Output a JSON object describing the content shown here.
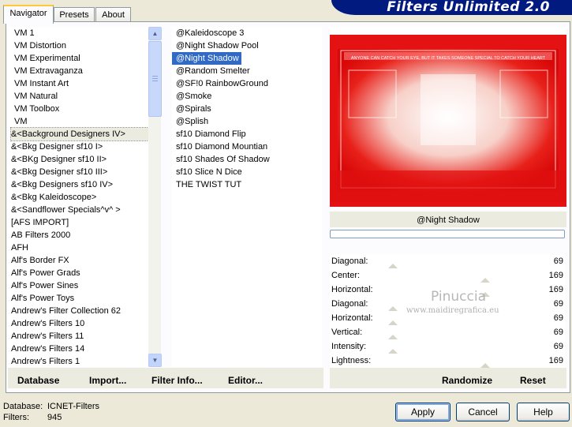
{
  "header": {
    "title": "Filters Unlimited 2.0"
  },
  "tabs": [
    {
      "label": "Navigator"
    },
    {
      "label": "Presets"
    },
    {
      "label": "About"
    }
  ],
  "categories": [
    "VM 1",
    "VM Distortion",
    "VM Experimental",
    "VM Extravaganza",
    "VM Instant Art",
    "VM Natural",
    "VM Toolbox",
    "VM",
    "&<Background Designers IV>",
    "&<Bkg Designer sf10 I>",
    "&<BKg Designer sf10 II>",
    "&<Bkg Designer sf10 III>",
    "&<Bkg Designers sf10 IV>",
    "&<Bkg Kaleidoscope>",
    "&<Sandflower Specials^v^ >",
    "[AFS IMPORT]",
    "AB Filters 2000",
    "AFH",
    "Alf's Border FX",
    "Alf's Power Grads",
    "Alf's Power Sines",
    "Alf's Power Toys",
    "Andrew's Filter Collection 62",
    "Andrew's Filters 10",
    "Andrew's Filters 11",
    "Andrew's Filters 14",
    "Andrew's Filters 1"
  ],
  "filters": [
    "@Kaleidoscope 3",
    "@Night Shadow Pool",
    "@Night Shadow",
    "@Random Smelter",
    "@SF!0 RainbowGround",
    "@Smoke",
    "@Spirals",
    "@Splish",
    "sf10 Diamond Flip",
    "sf10 Diamond Mountian",
    "sf10 Shades Of Shadow",
    "sf10 Slice N Dice",
    "THE TWIST TUT"
  ],
  "preview": {
    "banner_text": "ANYONE CAN CATCH YOUR EYE, BUT IT TAKES SOMEONE SPECIAL TO CATCH YOUR HEART",
    "filter_name": "@Night Shadow",
    "watermark": "Pinuccia",
    "watermark_url": "www.maidiregrafica.eu"
  },
  "sliders": [
    {
      "label": "Diagonal:",
      "value": "69",
      "level": 0.27
    },
    {
      "label": "Center:",
      "value": "169",
      "level": 0.66
    },
    {
      "label": "Horizontal:",
      "value": "169",
      "level": 0.66
    },
    {
      "label": "Diagonal:",
      "value": "69",
      "level": 0.27
    },
    {
      "label": "Horizontal:",
      "value": "69",
      "level": 0.27
    },
    {
      "label": "Vertical:",
      "value": "69",
      "level": 0.27
    },
    {
      "label": "Intensity:",
      "value": "69",
      "level": 0.27
    },
    {
      "label": "Lightness:",
      "value": "169",
      "level": 0.66
    }
  ],
  "bottom_links": {
    "database": "Database",
    "import": "Import...",
    "filter_info": "Filter Info...",
    "editor": "Editor...",
    "randomize": "Randomize",
    "reset": "Reset"
  },
  "status": {
    "database_label": "Database:",
    "database_value": "ICNET-Filters",
    "filters_label": "Filters:",
    "filters_value": "945"
  },
  "buttons": {
    "apply": "Apply",
    "cancel": "Cancel",
    "help": "Help"
  },
  "colors": {
    "accent": "#001a80",
    "selection": "#316ac5",
    "preview_red": "#e01010"
  }
}
